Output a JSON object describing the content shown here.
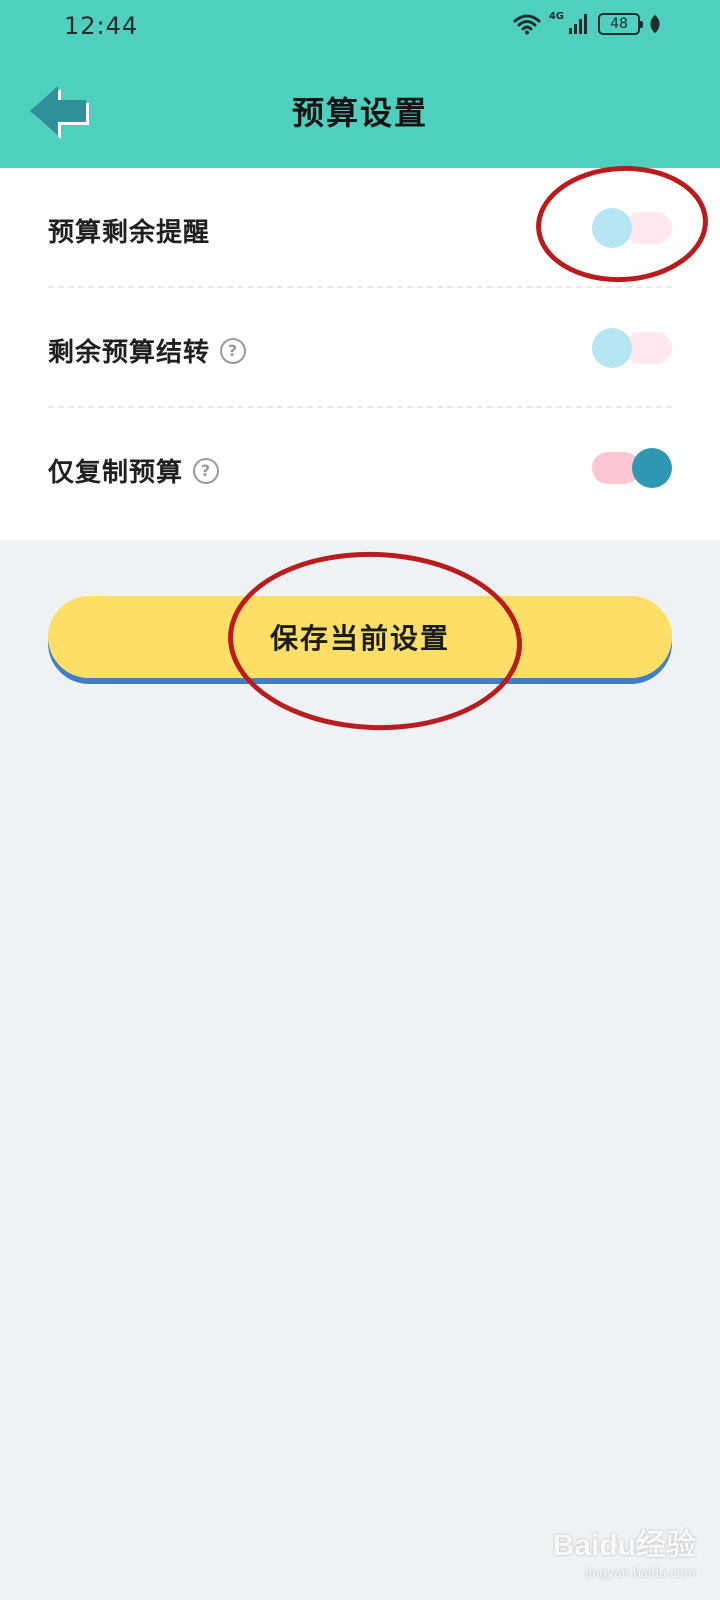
{
  "status_bar": {
    "time": "12:44",
    "signal_label": "4G",
    "battery": "48"
  },
  "header": {
    "title": "预算设置",
    "back_icon": "arrow-left-icon"
  },
  "settings": [
    {
      "label": "预算剩余提醒",
      "has_help": false,
      "enabled": false
    },
    {
      "label": "剩余预算结转",
      "has_help": true,
      "enabled": false
    },
    {
      "label": "仅复制预算",
      "has_help": true,
      "enabled": true
    }
  ],
  "help_glyph": "?",
  "save_button": {
    "label": "保存当前设置"
  },
  "watermark": {
    "logo": "Baidu经验",
    "url": "jingyan.baidu.com"
  },
  "colors": {
    "header": "#4fcfbe",
    "toggle_on_knob": "#2e97b3",
    "toggle_off_knob": "#b7e6f3",
    "save_button": "#fddf67",
    "annotation": "#b81c1c"
  }
}
